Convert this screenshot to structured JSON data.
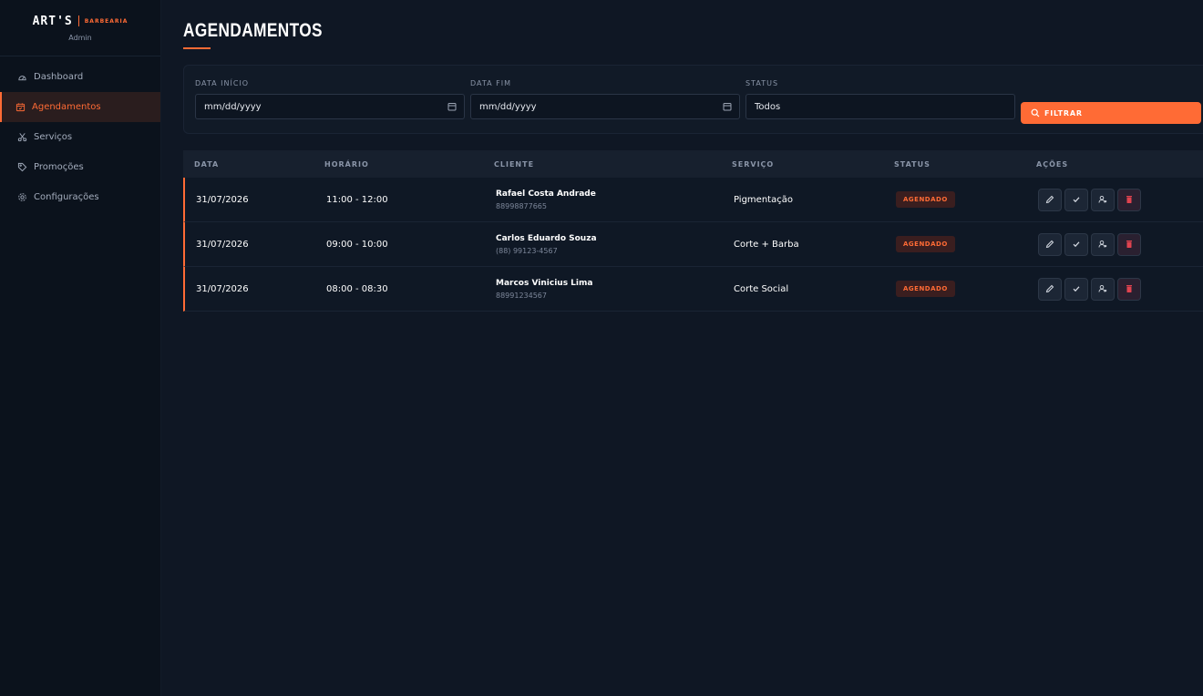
{
  "brand": {
    "name": "ART'S",
    "sub": "BARBEARIA",
    "role": "Admin"
  },
  "sidebar": {
    "items": [
      {
        "label": "Dashboard",
        "icon": "gauge-icon"
      },
      {
        "label": "Agendamentos",
        "icon": "calendar-icon",
        "active": true
      },
      {
        "label": "Serviços",
        "icon": "scissors-icon"
      },
      {
        "label": "Promoções",
        "icon": "tag-icon"
      },
      {
        "label": "Configurações",
        "icon": "gear-icon"
      }
    ]
  },
  "page": {
    "title": "AGENDAMENTOS"
  },
  "filters": {
    "start_label": "DATA INÍCIO",
    "start_value": "mm/dd/yyyy",
    "end_label": "DATA FIM",
    "end_value": "mm/dd/yyyy",
    "status_label": "STATUS",
    "status_value": "Todos",
    "button_label": "FILTRAR"
  },
  "table": {
    "headers": [
      "DATA",
      "HORÁRIO",
      "CLIENTE",
      "SERVIÇO",
      "STATUS",
      "AÇÕES"
    ],
    "rows": [
      {
        "date": "31/07/2026",
        "time": "11:00 - 12:00",
        "client": "Rafael Costa Andrade",
        "phone": "88998877665",
        "service": "Pigmentação",
        "status": "AGENDADO"
      },
      {
        "date": "31/07/2026",
        "time": "09:00 - 10:00",
        "client": "Carlos Eduardo Souza",
        "phone": "(88) 99123-4567",
        "service": "Corte + Barba",
        "status": "AGENDADO"
      },
      {
        "date": "31/07/2026",
        "time": "08:00 - 08:30",
        "client": "Marcos Vinicius Lima",
        "phone": "88991234567",
        "service": "Corte Social",
        "status": "AGENDADO"
      }
    ]
  },
  "colors": {
    "accent": "#ff6b35",
    "background": "#0f1724",
    "sidebar": "#0b121c"
  }
}
